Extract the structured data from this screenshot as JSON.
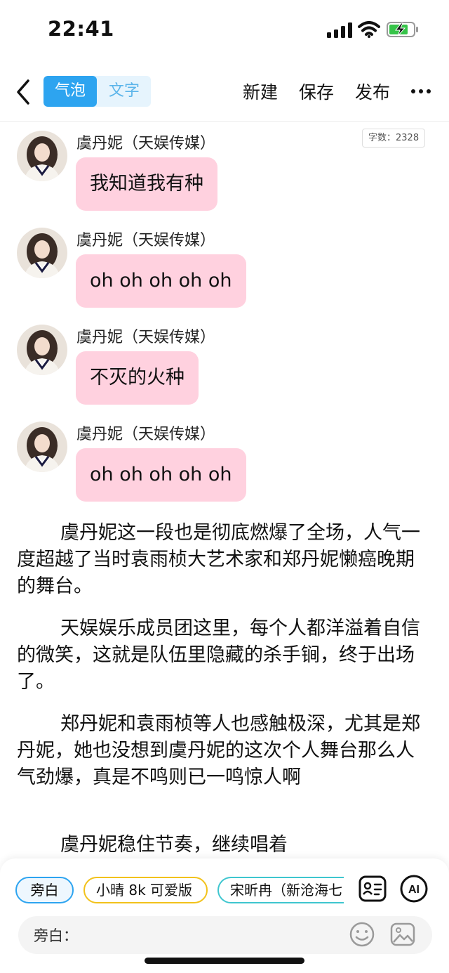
{
  "status_bar": {
    "time": "22:41"
  },
  "toolbar": {
    "mode_bubble": "气泡",
    "mode_text": "文字",
    "new_label": "新建",
    "save_label": "保存",
    "publish_label": "发布"
  },
  "word_count": "字数：2328",
  "messages": [
    {
      "sender": "虞丹妮（天娱传媒）",
      "text": "我知道我有种"
    },
    {
      "sender": "虞丹妮（天娱传媒）",
      "text": "oh oh oh oh oh"
    },
    {
      "sender": "虞丹妮（天娱传媒）",
      "text": "不灭的火种"
    },
    {
      "sender": "虞丹妮（天娱传媒）",
      "text": "oh oh oh oh oh"
    }
  ],
  "narration": [
    "虞丹妮这一段也是彻底燃爆了全场，人气一度超越了当时袁雨桢大艺术家和郑丹妮懒癌晚期的舞台。",
    "天娱娱乐成员团这里，每个人都洋溢着自信的微笑，这就是队伍里隐藏的杀手锏，终于出场了。",
    "郑丹妮和袁雨桢等人也感触极深，尤其是郑丹妮，她也没想到虞丹妮的这次个人舞台那么人气劲爆，真是不鸣则已一鸣惊人啊",
    "虞丹妮稳住节奏，继续唱着"
  ],
  "role_chips": [
    "旁白",
    "小晴 8k 可爱版",
    "宋昕冉（新沧海七"
  ],
  "input": {
    "label": "旁白："
  },
  "icons": {
    "back": "chevron-left-icon",
    "more": "more-dots-icon",
    "roles": "role-card-icon",
    "ai": "ai-icon",
    "emoji": "emoji-icon",
    "image": "image-icon"
  },
  "colors": {
    "accent": "#2da4f0",
    "bubble": "#ffd1df",
    "chip_yellow": "#f2c21b",
    "chip_teal": "#3ec6cf"
  }
}
